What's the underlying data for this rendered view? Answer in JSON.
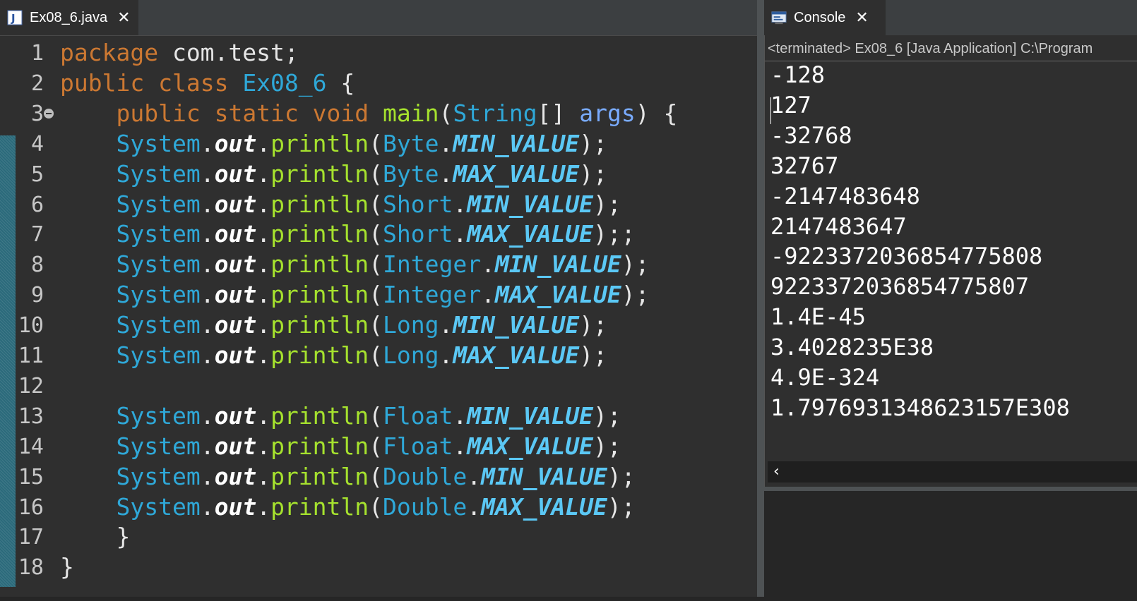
{
  "editor": {
    "tab": {
      "title": "Ex08_6.java",
      "icon": "java-file-icon",
      "close": "✕"
    },
    "lines": [
      {
        "no": "1",
        "html": "<span class=\"kw\">package</span><span class=\"pl\"> com.test;</span>"
      },
      {
        "no": "2",
        "html": "<span class=\"kw\">public</span> <span class=\"kw\">class</span> <span class=\"cls\">Ex08_6</span><span class=\"pl\"> {</span>"
      },
      {
        "no": "3",
        "html": "    <span class=\"kw\">public</span> <span class=\"kw\">static</span> <span class=\"kw\">void</span> <span class=\"mth\">main</span><span class=\"pl\">(</span><span class=\"cls\">String</span><span class=\"pl\">[] </span><span class=\"arg\">args</span><span class=\"pl\">) {</span>",
        "fold": true
      },
      {
        "no": "4",
        "html": "    <span class=\"cls\">System</span>.<span class=\"fld\">out</span>.<span class=\"mth\">println</span>(<span class=\"cls\">Byte</span>.<span class=\"cst\">MIN_VALUE</span>);"
      },
      {
        "no": "5",
        "html": "    <span class=\"cls\">System</span>.<span class=\"fld\">out</span>.<span class=\"mth\">println</span>(<span class=\"cls\">Byte</span>.<span class=\"cst\">MAX_VALUE</span>);"
      },
      {
        "no": "6",
        "html": "    <span class=\"cls\">System</span>.<span class=\"fld\">out</span>.<span class=\"mth\">println</span>(<span class=\"cls\">Short</span>.<span class=\"cst\">MIN_VALUE</span>);"
      },
      {
        "no": "7",
        "html": "    <span class=\"cls\">System</span>.<span class=\"fld\">out</span>.<span class=\"mth\">println</span>(<span class=\"cls\">Short</span>.<span class=\"cst\">MAX_VALUE</span>);;"
      },
      {
        "no": "8",
        "html": "    <span class=\"cls\">System</span>.<span class=\"fld\">out</span>.<span class=\"mth\">println</span>(<span class=\"cls\">Integer</span>.<span class=\"cst\">MIN_VALUE</span>);"
      },
      {
        "no": "9",
        "html": "    <span class=\"cls\">System</span>.<span class=\"fld\">out</span>.<span class=\"mth\">println</span>(<span class=\"cls\">Integer</span>.<span class=\"cst\">MAX_VALUE</span>);"
      },
      {
        "no": "10",
        "html": "    <span class=\"cls\">System</span>.<span class=\"fld\">out</span>.<span class=\"mth\">println</span>(<span class=\"cls\">Long</span>.<span class=\"cst\">MIN_VALUE</span>);"
      },
      {
        "no": "11",
        "html": "    <span class=\"cls\">System</span>.<span class=\"fld\">out</span>.<span class=\"mth\">println</span>(<span class=\"cls\">Long</span>.<span class=\"cst\">MAX_VALUE</span>);"
      },
      {
        "no": "12",
        "html": ""
      },
      {
        "no": "13",
        "html": "    <span class=\"cls\">System</span>.<span class=\"fld\">out</span>.<span class=\"mth\">println</span>(<span class=\"cls\">Float</span>.<span class=\"cst\">MIN_VALUE</span>);"
      },
      {
        "no": "14",
        "html": "    <span class=\"cls\">System</span>.<span class=\"fld\">out</span>.<span class=\"mth\">println</span>(<span class=\"cls\">Float</span>.<span class=\"cst\">MAX_VALUE</span>);"
      },
      {
        "no": "15",
        "html": "    <span class=\"cls\">System</span>.<span class=\"fld\">out</span>.<span class=\"mth\">println</span>(<span class=\"cls\">Double</span>.<span class=\"cst\">MIN_VALUE</span>);"
      },
      {
        "no": "16",
        "html": "    <span class=\"cls\">System</span>.<span class=\"fld\">out</span>.<span class=\"mth\">println</span>(<span class=\"cls\">Double</span>.<span class=\"cst\">MAX_VALUE</span>);"
      },
      {
        "no": "17",
        "html": "    }"
      },
      {
        "no": "18",
        "html": "}"
      }
    ]
  },
  "console": {
    "tab": {
      "title": "Console",
      "icon": "console-icon",
      "close": "✕"
    },
    "header": "<terminated> Ex08_6 [Java Application] C:\\Program",
    "output": [
      "-128",
      "127",
      "-32768",
      "32767",
      "-2147483648",
      "2147483647",
      "-9223372036854775808",
      "9223372036854775807",
      "1.4E-45",
      "3.4028235E38",
      "4.9E-324",
      "1.7976931348623157E308"
    ],
    "scroll_left": "‹"
  },
  "colors": {
    "keyword": "#cc7832",
    "class": "#2fa8d8",
    "method": "#a6e22e",
    "constant": "#5bc8f5",
    "background": "#2f2f2f"
  }
}
